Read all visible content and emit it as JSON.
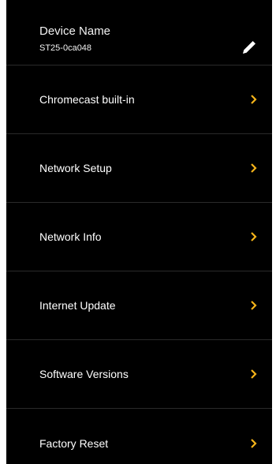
{
  "device": {
    "title": "Device Name",
    "value": "ST25-0ca048",
    "edit_icon": "pencil-icon"
  },
  "menu": {
    "items": [
      {
        "label": "Chromecast built-in",
        "icon": "chevron-right-icon"
      },
      {
        "label": "Network Setup",
        "icon": "chevron-right-icon"
      },
      {
        "label": "Network Info",
        "icon": "chevron-right-icon"
      },
      {
        "label": "Internet Update",
        "icon": "chevron-right-icon"
      },
      {
        "label": "Software Versions",
        "icon": "chevron-right-icon"
      },
      {
        "label": "Factory Reset",
        "icon": "chevron-right-icon"
      }
    ]
  },
  "colors": {
    "background": "#000000",
    "text": "#ffffff",
    "accent": "#f5b41a",
    "divider": "#2a2a2a"
  }
}
